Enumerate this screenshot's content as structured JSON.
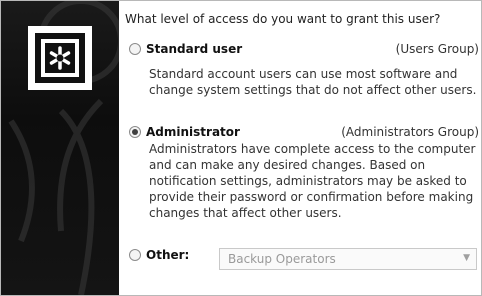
{
  "question": "What level of access do you want to grant this user?",
  "options": [
    {
      "label": "Standard user",
      "group": "(Users Group)",
      "selected": false,
      "description": "Standard account users can use most software and change system settings that do not affect other users."
    },
    {
      "label": "Administrator",
      "group": "(Administrators Group)",
      "selected": true,
      "description": "Administrators have complete access to the computer and can make any desired changes. Based on notification settings, administrators may be asked to provide their password or confirmation before making changes that affect other users."
    },
    {
      "label": "Other:",
      "selected": false,
      "dropdown_value": "Backup Operators",
      "dropdown_enabled": false
    }
  ],
  "icons": {
    "user_accounts": "user-accounts-icon"
  },
  "colors": {
    "panel_background": "#111111",
    "disabled_text": "#9a9a9a"
  }
}
